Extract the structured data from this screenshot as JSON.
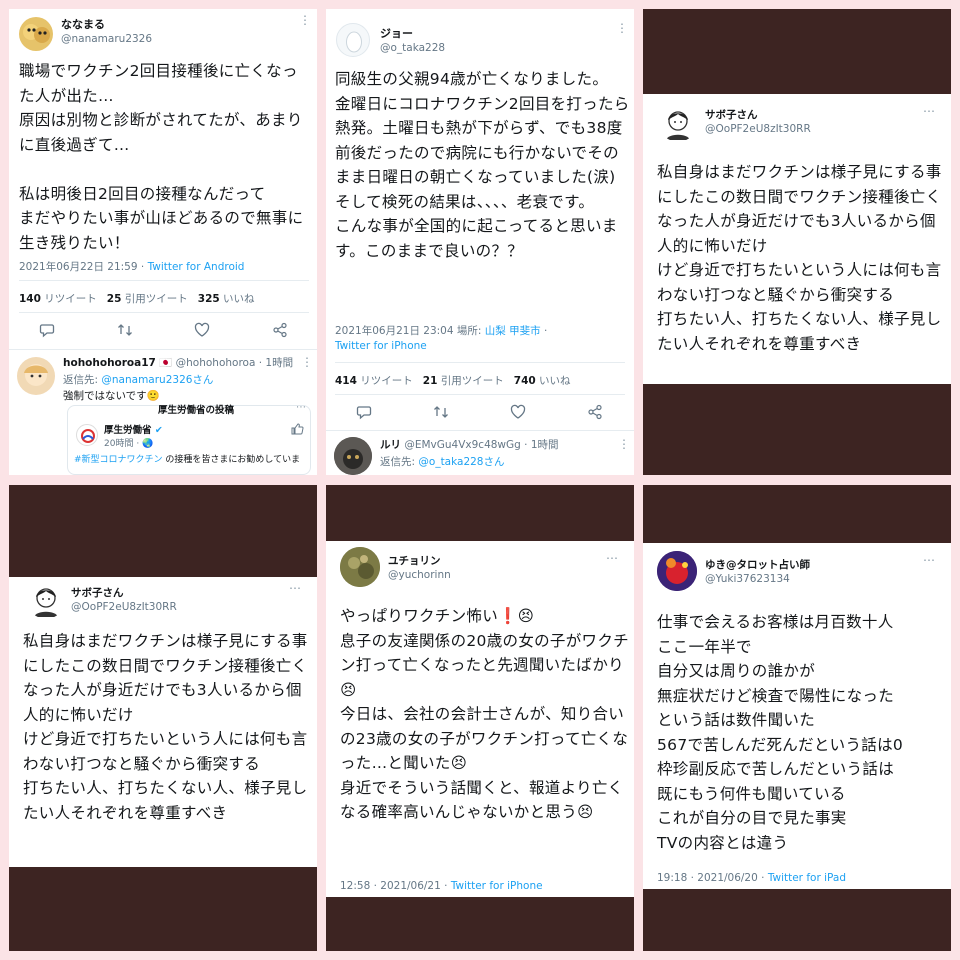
{
  "colors": {
    "page_bg": "#fbe3e6",
    "frame_brown": "#3d2422",
    "link_blue": "#1da1f2",
    "muted": "#657786"
  },
  "panel1": {
    "name": "ななまる",
    "handle": "@nanamaru2326",
    "text": "職場でワクチン2回目接種後に亡くなった人が出た…\n原因は別物と診断がされてたが、あまりに直後過ぎて…\n\n私は明後日2回目の接種なんだって\nまだやりたい事が山ほどあるので無事に生き残りたい！",
    "timestamp": "2021年06月22日 21:59 · ",
    "client": "Twitter for Android",
    "retweets": "140",
    "retweets_label": "リツイート",
    "quotes": "25",
    "quotes_label": "引用ツイート",
    "likes": "325",
    "likes_label": "いいね",
    "reply": {
      "name": "hohohohoroa17",
      "flag": "🇯🇵",
      "handle": "@hohohohoroa · 1時間",
      "reply_to_label": "返信先: ",
      "reply_to": "@nanamaru2326さん",
      "text": "強制ではないです🙂",
      "embed_header": "厚生労働省の投稿",
      "embed_name": "厚生労働省",
      "embed_time": "20時間 · 🌏",
      "embed_tag": "#新型コロナワクチン",
      "embed_text": " の接種を皆さまにお勧めしていま"
    }
  },
  "panel2": {
    "name": "ジョー",
    "handle": "@o_taka228",
    "text": "同級生の父親94歳が亡くなりました。\n金曜日にコロナワクチン2回目を打ったら熱発。土曜日も熱が下がらず、でも38度前後だったので病院にも行かないでそのまま日曜日の朝亡くなっていました(涙)\nそして検死の結果は、、、、老衰です。\nこんな事が全国的に起こってると思います。このままで良いの？？",
    "timestamp": "2021年06月21日 23:04 場所: ",
    "place": "山梨 甲斐市",
    "sep": " ·",
    "client": "Twitter for iPhone",
    "retweets": "414",
    "retweets_label": "リツイート",
    "quotes": "21",
    "quotes_label": "引用ツイート",
    "likes": "740",
    "likes_label": "いいね",
    "reply": {
      "name": "ルリ",
      "handle": "@EMvGu4Vx9c48wGg · 1時間",
      "reply_to_label": "返信先: ",
      "reply_to": "@o_taka228さん"
    }
  },
  "panel3": {
    "name": "サボ子さん",
    "handle": "@OoPF2eU8zIt30RR",
    "text": "私自身はまだワクチンは様子見にする事にしたこの数日間でワクチン接種後亡くなった人が身近だけでも3人いるから個人的に怖いだけ\nけど身近で打ちたいという人には何も言わない打つなと騒ぐから衝突する\n打ちたい人、打ちたくない人、様子見したい人それぞれを尊重すべき"
  },
  "panel4": {
    "name": "サボ子さん",
    "handle": "@OoPF2eU8zIt30RR",
    "text": "私自身はまだワクチンは様子見にする事にしたこの数日間でワクチン接種後亡くなった人が身近だけでも3人いるから個人的に怖いだけ\nけど身近で打ちたいという人には何も言わない打つなと騒ぐから衝突する\n打ちたい人、打ちたくない人、様子見したい人それぞれを尊重すべき"
  },
  "panel5": {
    "name": "ユチョリン",
    "handle": "@yuchorinn",
    "text": "やっぱりワクチン怖い❗😣\n息子の友達関係の20歳の女の子がワクチン打って亡くなったと先週聞いたばかり😣\n今日は、会社の会計士さんが、知り合いの23歳の女の子がワクチン打って亡くなった…と聞いた😣\n身近でそういう話聞くと、報道より亡くなる確率高いんじゃないかと思う😣",
    "timestamp": "12:58 · 2021/06/21 · ",
    "client": "Twitter for iPhone"
  },
  "panel6": {
    "name": "ゆき@タロット占い師",
    "handle": "@Yuki37623134",
    "text": "仕事で会えるお客様は月百数十人\nここ一年半で\n自分又は周りの誰かが\n無症状だけど検査で陽性になった\nという話は数件聞いた\n567で苦しんだ死んだという話は0\n枠珍副反応で苦しんだという話は\n既にもう何件も聞いている\nこれが自分の目で見た事実\nTVの内容とは違う",
    "timestamp": "19:18 · 2021/06/20 · ",
    "client": "Twitter for iPad"
  }
}
